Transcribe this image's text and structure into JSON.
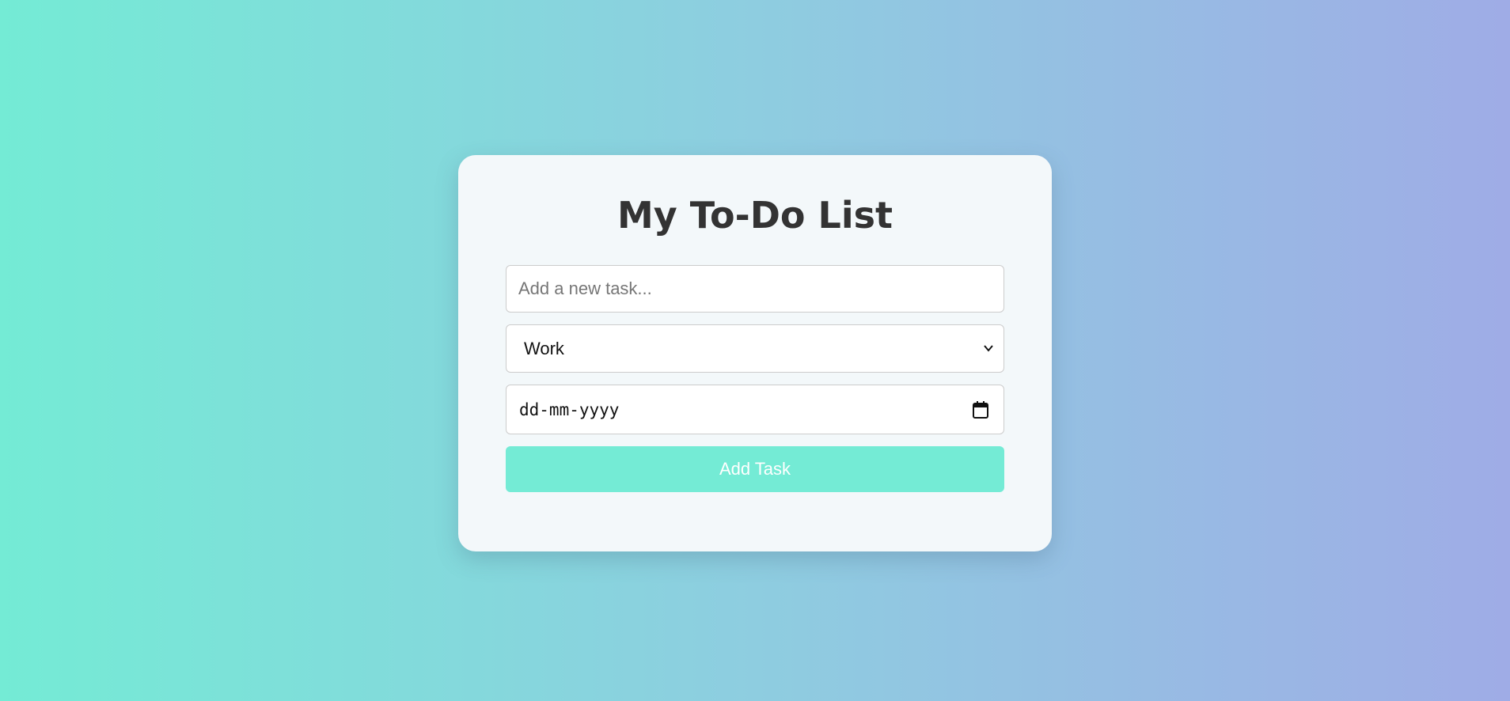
{
  "app": {
    "title": "My To-Do List"
  },
  "form": {
    "task_placeholder": "Add a new task...",
    "task_value": "",
    "category_selected": "Work",
    "date_placeholder": "dd-mm-yyyy",
    "add_button_label": "Add Task"
  },
  "icons": {
    "dropdown": "chevron-down-icon",
    "date_picker": "calendar-icon"
  },
  "colors": {
    "gradient_start": "#74ebd5",
    "gradient_end": "#9face6",
    "accent": "#74ebd5",
    "title": "#333333"
  }
}
